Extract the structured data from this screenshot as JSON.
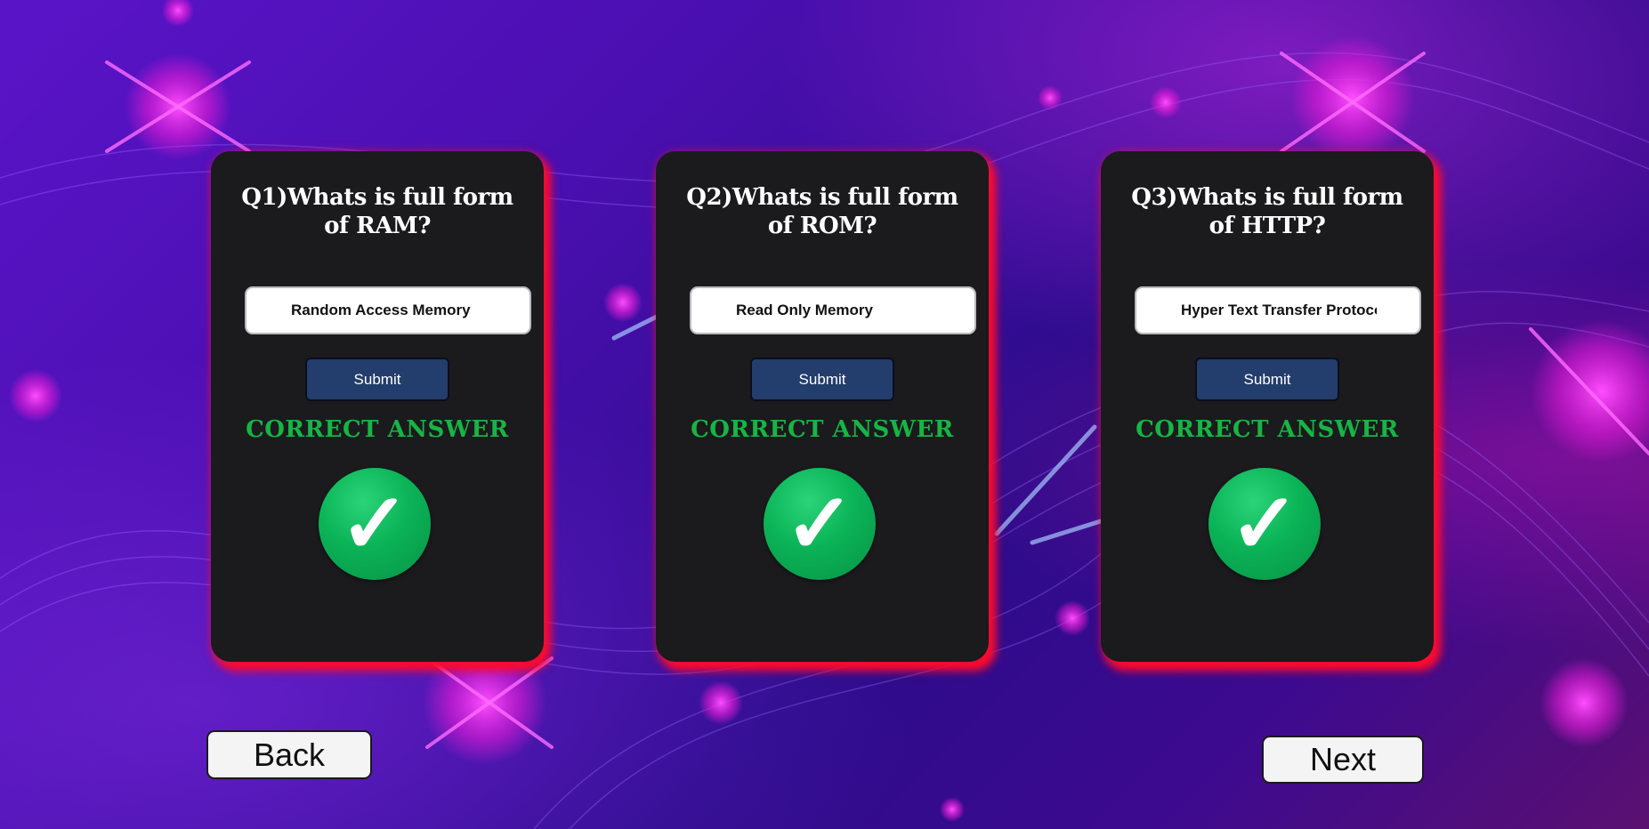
{
  "cards": [
    {
      "question": "Q1)Whats is full form of RAM?",
      "answer_value": "Random Access Memory",
      "submit_label": "Submit",
      "result": "CORRECT ANSWER",
      "result_icon": "✓"
    },
    {
      "question": "Q2)Whats is full form of ROM?",
      "answer_value": "Read Only Memory",
      "submit_label": "Submit",
      "result": "CORRECT ANSWER",
      "result_icon": "✓"
    },
    {
      "question": "Q3)Whats is full form of HTTP?",
      "answer_value": "Hyper Text Transfer Protocol",
      "submit_label": "Submit",
      "result": "CORRECT ANSWER",
      "result_icon": "✓"
    }
  ],
  "nav": {
    "back_label": "Back",
    "next_label": "Next"
  },
  "colors": {
    "card_bg": "#1b1a1d",
    "card_glow": "#ff0a2c",
    "submit_bg": "#233d6c",
    "correct": "#16b545",
    "check_green": "#0bb357"
  }
}
